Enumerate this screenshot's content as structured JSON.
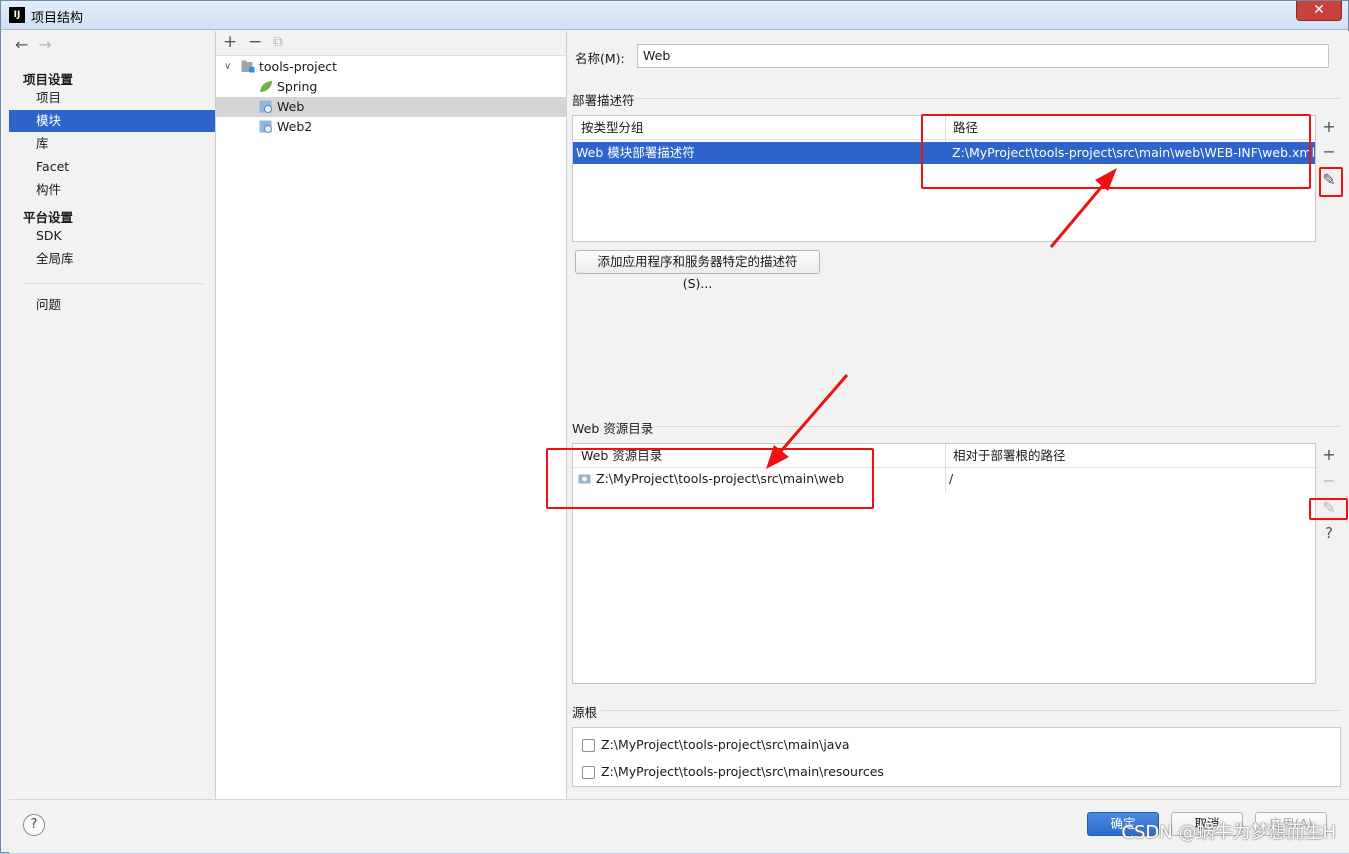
{
  "window": {
    "title": "项目结构",
    "app_icon": "IJ",
    "close": "✕"
  },
  "nav": {
    "back": "←",
    "forward": "→"
  },
  "sidebar": {
    "project_settings": "项目设置",
    "project_items": [
      "项目",
      "模块",
      "库",
      "Facet",
      "构件"
    ],
    "platform_settings": "平台设置",
    "platform_items": [
      "SDK",
      "全局库"
    ],
    "problems": "问题"
  },
  "tree_toolbar": {
    "add": "+",
    "remove": "−",
    "copy": "⧉"
  },
  "tree": {
    "root": "tools-project",
    "children": [
      "Spring",
      "Web",
      "Web2"
    ]
  },
  "main": {
    "name_label": "名称(M):",
    "name_value": "Web",
    "deploy": {
      "title": "部署描述符",
      "columns": [
        "按类型分组",
        "路径"
      ],
      "row": [
        "Web 模块部署描述符",
        "Z:\\MyProject\\tools-project\\src\\main\\web\\WEB-INF\\web.xml"
      ],
      "add_button": "添加应用程序和服务器特定的描述符(S)..."
    },
    "webres": {
      "title": "Web 资源目录",
      "columns": [
        "Web 资源目录",
        "相对于部署根的路径"
      ],
      "row": [
        "Z:\\MyProject\\tools-project\\src\\main\\web",
        "/"
      ]
    },
    "source_roots": {
      "title": "源根",
      "items": [
        "Z:\\MyProject\\tools-project\\src\\main\\java",
        "Z:\\MyProject\\tools-project\\src\\main\\resources"
      ]
    },
    "side_tools": {
      "add": "+",
      "remove": "−",
      "edit": "✎",
      "help": "?"
    }
  },
  "footer": {
    "help": "?",
    "ok": "确定",
    "cancel": "取消",
    "apply": "应用(A)"
  },
  "watermark": "CSDN @蜗牛为梦想而生H",
  "colors": {
    "selection": "#2f65ca",
    "annotation": "#ee1111"
  }
}
